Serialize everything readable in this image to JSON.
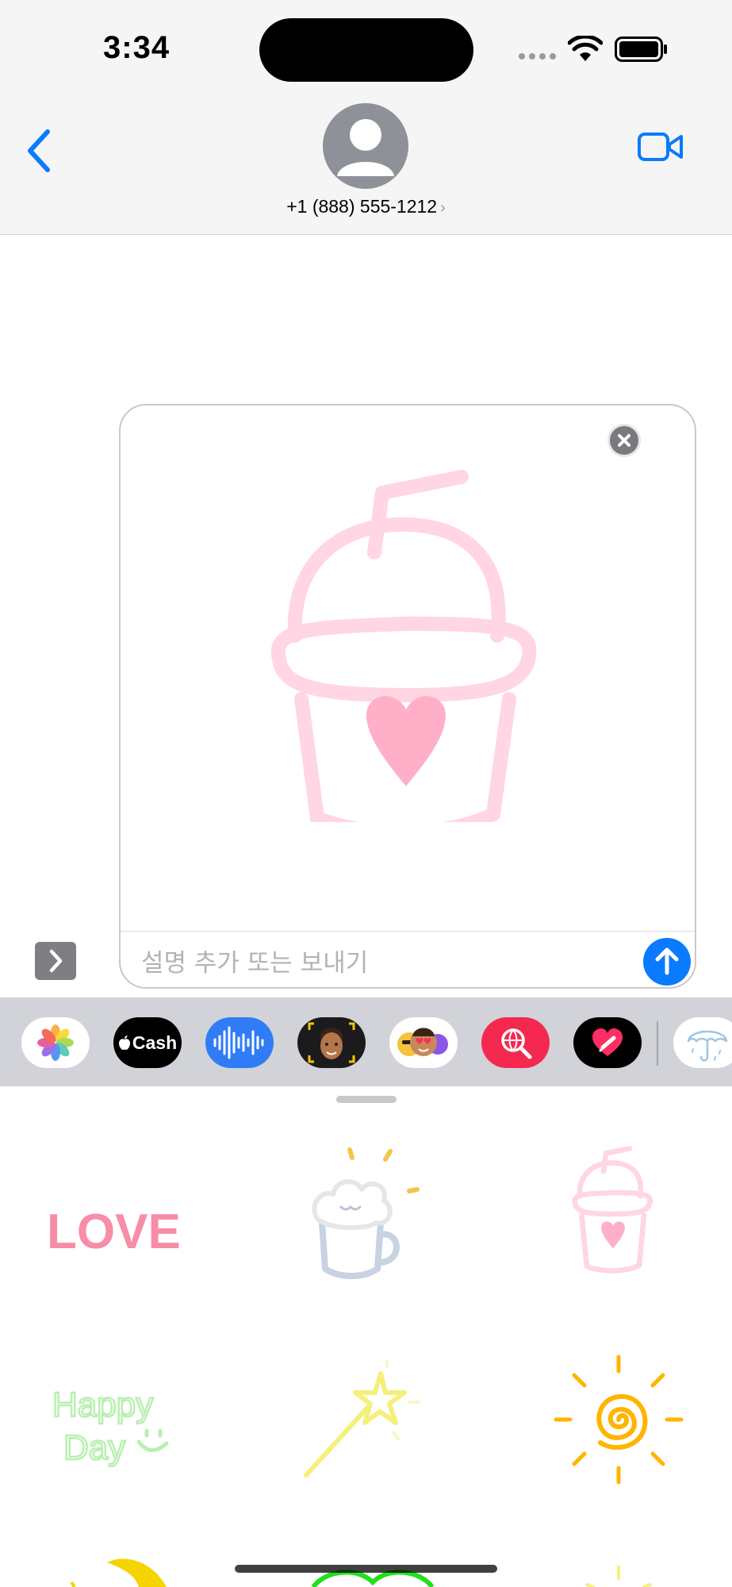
{
  "status_bar": {
    "time": "3:34",
    "signal_icon": "signal-dots-icon",
    "wifi_icon": "wifi-icon",
    "battery_icon": "battery-icon"
  },
  "header": {
    "contact": "+1 (888) 555-1212",
    "contact_chevron": "›",
    "back_icon": "chevron-left-icon",
    "video_icon": "video-camera-icon",
    "avatar_icon": "person-icon"
  },
  "compose": {
    "attachment": "sticker-drink-cup",
    "placeholder": "설명 추가 또는 보내기",
    "value": ""
  },
  "app_strip": {
    "items": [
      {
        "name": "photos",
        "icon": "photos-icon"
      },
      {
        "name": "apple-cash",
        "label": "Cash"
      },
      {
        "name": "audio",
        "icon": "waveform-icon"
      },
      {
        "name": "memoji",
        "icon": "memoji-icon"
      },
      {
        "name": "memoji-stickers",
        "icon": "memoji-stickers-icon"
      },
      {
        "name": "image-search",
        "icon": "globe-search-icon"
      },
      {
        "name": "digital-touch",
        "icon": "heart-touch-icon"
      },
      {
        "name": "sticker-app",
        "icon": "umbrella-icon"
      }
    ]
  },
  "stickers": [
    {
      "name": "love",
      "text": "LOVE"
    },
    {
      "name": "beer-mug"
    },
    {
      "name": "drink-cup"
    },
    {
      "name": "happy-day",
      "line1": "Happy",
      "line2": "Day"
    },
    {
      "name": "magic-wand"
    },
    {
      "name": "sun"
    }
  ],
  "colors": {
    "accent": "#0a7aff",
    "sticker_pink": "#ffd6e2",
    "heart_pink": "#ffb0c8",
    "happy_green": "#b9f0b0",
    "wand_yellow": "#f5f07a",
    "sun_orange": "#ffb400"
  }
}
